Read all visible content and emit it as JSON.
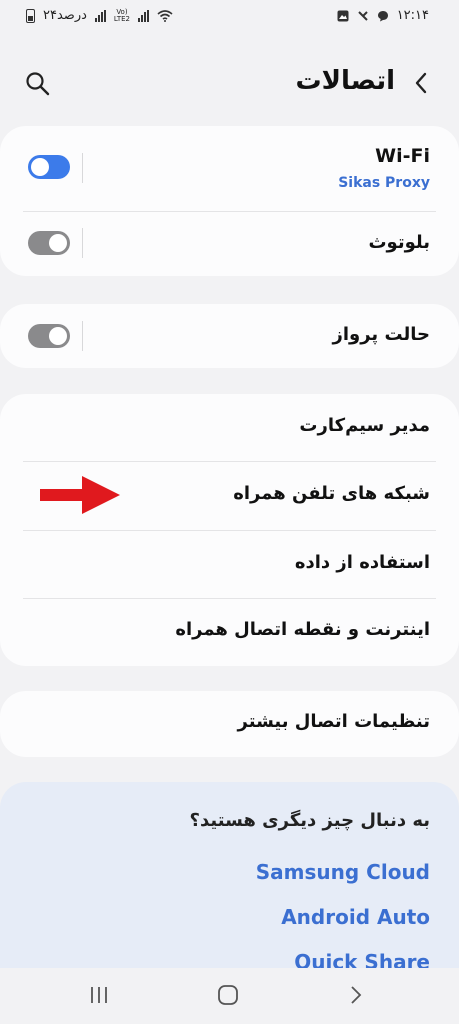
{
  "status_bar": {
    "time": "۱۲:۱۴",
    "battery": "۲۴درصد",
    "volte_top": "Vo)",
    "volte_bottom": "LTE2"
  },
  "header": {
    "title": "اتصالات"
  },
  "groups": {
    "wifi": {
      "label": "Wi-Fi",
      "sub": "Sikas Proxy",
      "enabled": true
    },
    "bluetooth": {
      "label": "بلوتوث",
      "enabled": false
    },
    "airplane": {
      "label": "حالت پرواز",
      "enabled": false
    },
    "sim_manager": {
      "label": "مدیر سیم‌کارت"
    },
    "mobile_networks": {
      "label": "شبکه های تلفن همراه"
    },
    "data_usage": {
      "label": "استفاده از داده"
    },
    "hotspot": {
      "label": "اینترنت و نقطه اتصال همراه"
    },
    "more": {
      "label": "تنظیمات اتصال بیشتر"
    }
  },
  "tips": {
    "question": "به دنبال چیز دیگری هستید؟",
    "links": [
      "Samsung Cloud",
      "Android Auto",
      "Quick Share"
    ]
  },
  "colors": {
    "accent": "#3c7bea",
    "link": "#3b6fd1",
    "annotation_arrow": "#e0191e"
  }
}
